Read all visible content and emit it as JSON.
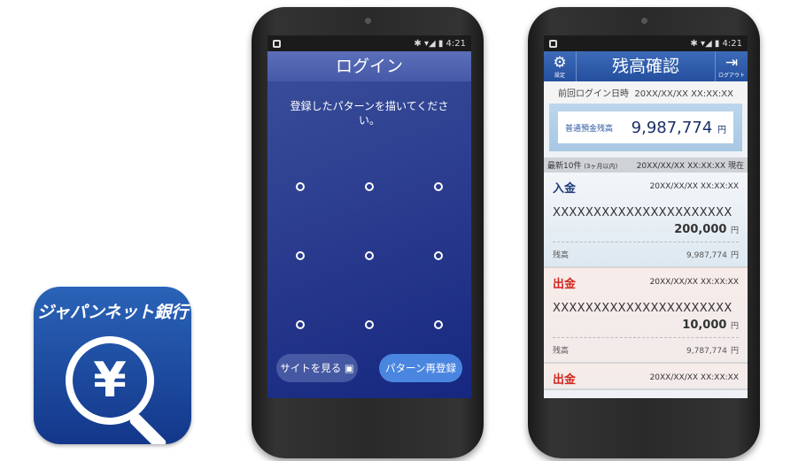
{
  "app_icon": {
    "name": "ジャパンネット銀行",
    "symbol": "¥",
    "icon": "yen-magnifier-icon"
  },
  "status": {
    "time": "4:21",
    "icons": [
      "bluetooth-icon",
      "wifi-icon",
      "signal-icon",
      "battery-icon"
    ]
  },
  "login": {
    "title": "ログイン",
    "message": "登録したパターンを描いてください。",
    "site_button": "サイトを見る",
    "reregister_button": "パターン再登録",
    "pattern_dots": 9
  },
  "balance": {
    "title": "残高確認",
    "settings_label": "設定",
    "logout_label": "ログアウト",
    "last_login_label": "前回ログイン日時",
    "last_login_value": "20XX/XX/XX XX:XX:XX",
    "account_label": "普通預金残高",
    "account_amount": "9,987,774",
    "yen": "円",
    "recent_label": "最新10件",
    "recent_sub": "(3ヶ月以内)",
    "as_of": "20XX/XX/XX XX:XX:XX 現在",
    "transactions": [
      {
        "type": "入金",
        "date": "20XX/XX/XX XX:XX:XX",
        "description": "XXXXXXXXXXXXXXXXXXXXXX",
        "amount": "200,000",
        "balance_label": "残高",
        "balance": "9,987,774"
      },
      {
        "type": "出金",
        "date": "20XX/XX/XX XX:XX:XX",
        "description": "XXXXXXXXXXXXXXXXXXXXXX",
        "amount": "10,000",
        "balance_label": "残高",
        "balance": "9,787,774"
      },
      {
        "type": "出金",
        "date": "20XX/XX/XX XX:XX:XX"
      }
    ]
  },
  "colors": {
    "brand_blue": "#244f9e",
    "deposit": "#1f3a7a",
    "withdrawal": "#d0281e"
  }
}
